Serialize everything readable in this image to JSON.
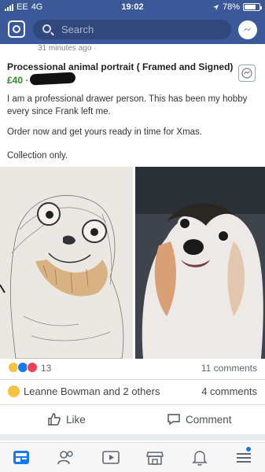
{
  "status_bar": {
    "carrier": "EE",
    "network": "4G",
    "time": "19:02",
    "battery": "78%",
    "battery_level": 0.78
  },
  "header": {
    "search_placeholder": "Search"
  },
  "post": {
    "cut_meta": "31 minutes ago · ",
    "title": "Processional animal portrait ( Framed and Signed)",
    "price": "£40 ·",
    "description": [
      "I am a professional drawer person. This has been my hobby every since Frank left me.",
      "Order now and get yours ready in time for Xmas.",
      "Collection only."
    ]
  },
  "reactions": {
    "count": "13",
    "comments": "11 comments"
  },
  "shared": {
    "liked_by": "Leanne Bowman and 2 others",
    "comments": "4 comments"
  },
  "actions": {
    "like": "Like",
    "comment": "Comment"
  },
  "tabs": [
    "news-feed",
    "friends",
    "watch",
    "marketplace",
    "notifications",
    "menu"
  ],
  "colors": {
    "brand": "#3b5998",
    "accent": "#1877f2",
    "price": "#2d8a2d"
  }
}
